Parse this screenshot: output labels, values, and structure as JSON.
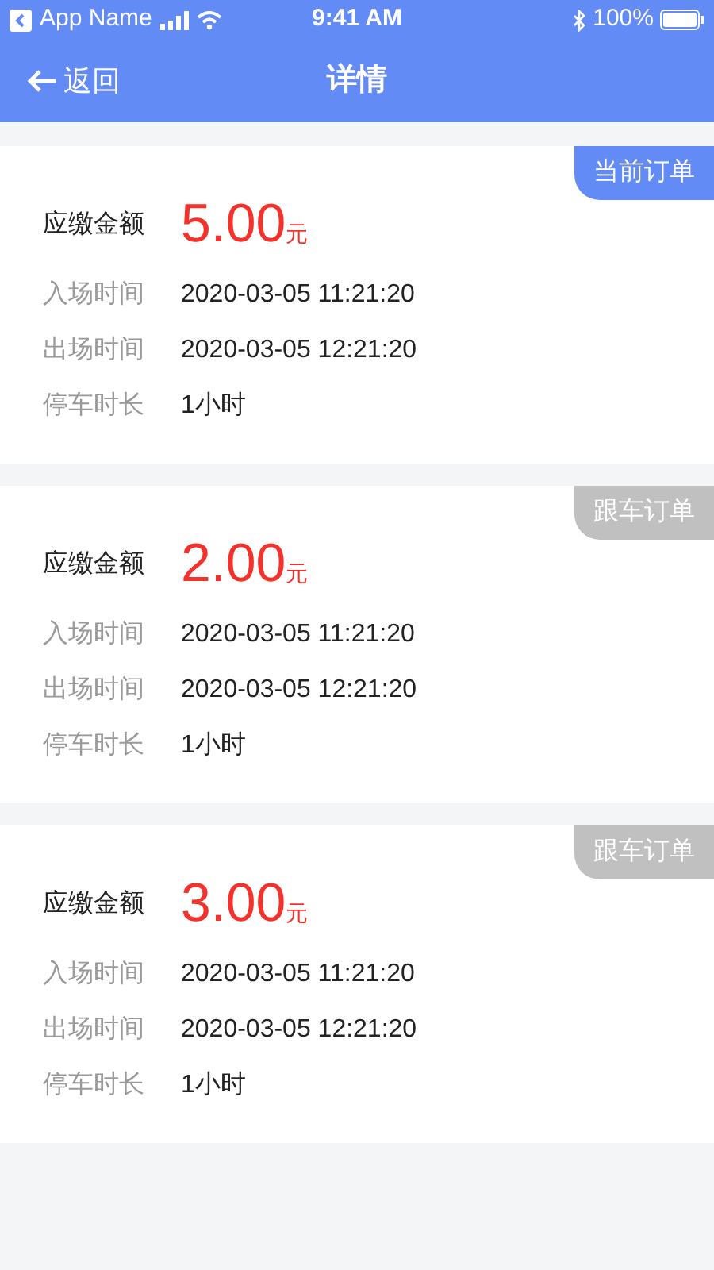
{
  "status_bar": {
    "app": "App Name",
    "time": "9:41 AM",
    "battery": "100%"
  },
  "nav": {
    "back": "返回",
    "title": "详情"
  },
  "orders": [
    {
      "badge": "当前订单",
      "current": true,
      "amount_label": "应缴金额",
      "amount": "5.00",
      "unit": "元",
      "rows": [
        {
          "label": "入场时间",
          "value": "2020-03-05 11:21:20"
        },
        {
          "label": "出场时间",
          "value": "2020-03-05 12:21:20"
        },
        {
          "label": "停车时长",
          "value": "1小时"
        }
      ]
    },
    {
      "badge": "跟车订单",
      "current": false,
      "amount_label": "应缴金额",
      "amount": "2.00",
      "unit": "元",
      "rows": [
        {
          "label": "入场时间",
          "value": "2020-03-05 11:21:20"
        },
        {
          "label": "出场时间",
          "value": "2020-03-05 12:21:20"
        },
        {
          "label": "停车时长",
          "value": "1小时"
        }
      ]
    },
    {
      "badge": "跟车订单",
      "current": false,
      "amount_label": "应缴金额",
      "amount": "3.00",
      "unit": "元",
      "rows": [
        {
          "label": "入场时间",
          "value": "2020-03-05 11:21:20"
        },
        {
          "label": "出场时间",
          "value": "2020-03-05 12:21:20"
        },
        {
          "label": "停车时长",
          "value": "1小时"
        }
      ]
    }
  ]
}
